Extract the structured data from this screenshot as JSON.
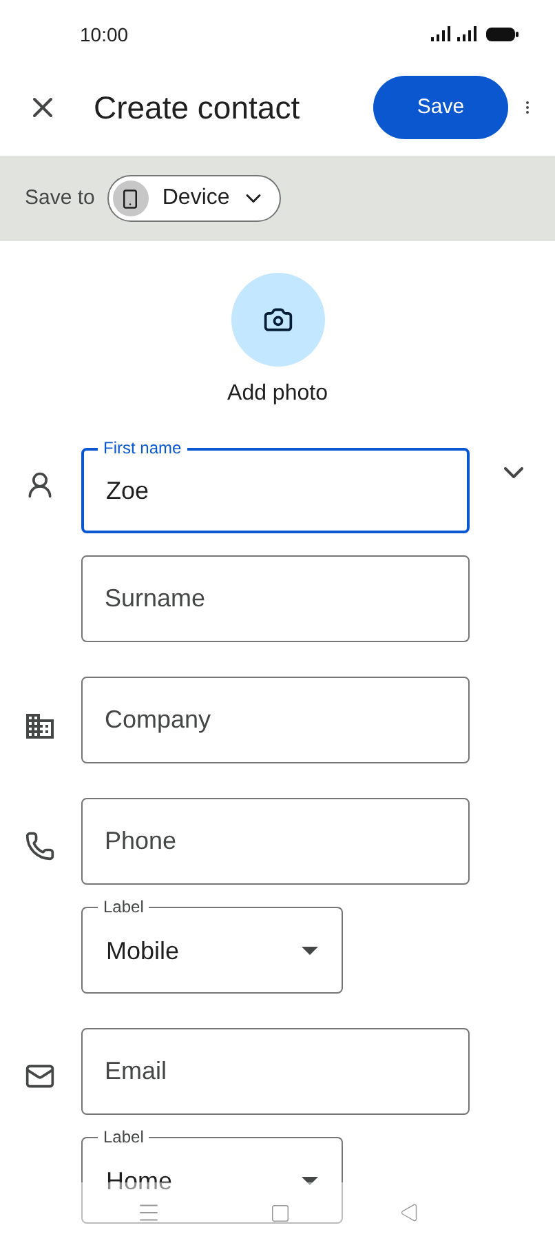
{
  "status_bar": {
    "time": "10:00"
  },
  "top_bar": {
    "title": "Create contact",
    "save_button": "Save"
  },
  "save_to": {
    "label": "Save to",
    "account": "Device"
  },
  "photo": {
    "label": "Add photo"
  },
  "sections": [
    {
      "kind": "person",
      "expandable": true,
      "fields": [
        {
          "kind": "text",
          "label": "First name",
          "value": "Zoe",
          "focused": true
        },
        {
          "kind": "text",
          "placeholder": "Surname",
          "focused": false
        }
      ]
    },
    {
      "kind": "business",
      "expandable": false,
      "fields": [
        {
          "kind": "text",
          "placeholder": "Company",
          "focused": false
        }
      ]
    },
    {
      "kind": "phone",
      "expandable": false,
      "fields": [
        {
          "kind": "text",
          "placeholder": "Phone",
          "focused": false
        },
        {
          "kind": "select",
          "label": "Label",
          "value": "Mobile"
        }
      ]
    },
    {
      "kind": "email",
      "expandable": false,
      "fields": [
        {
          "kind": "text",
          "placeholder": "Email",
          "focused": false
        },
        {
          "kind": "select",
          "label": "Label",
          "value": "Home"
        }
      ]
    }
  ]
}
